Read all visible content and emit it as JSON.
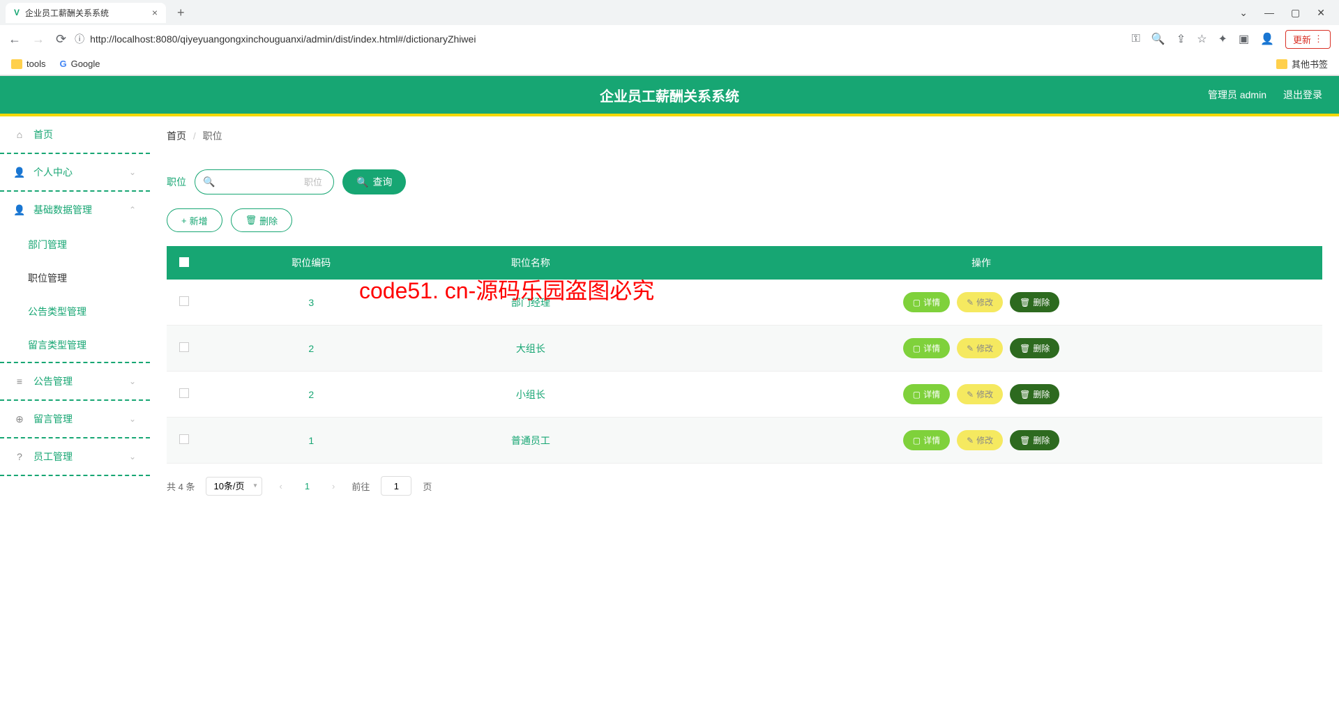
{
  "browser": {
    "tab_title": "企业员工薪酬关系系统",
    "url": "http://localhost:8080/qiyeyuangongxinchouguanxi/admin/dist/index.html#/dictionaryZhiwei",
    "update_label": "更新",
    "bookmarks": {
      "tools": "tools",
      "google": "Google",
      "other": "其他书签"
    }
  },
  "header": {
    "title": "企业员工薪酬关系系统",
    "user_label": "管理员 admin",
    "logout_label": "退出登录"
  },
  "sidebar": {
    "home": "首页",
    "personal": "个人中心",
    "basedata": "基础数据管理",
    "sub": {
      "dept": "部门管理",
      "position": "职位管理",
      "notice_type": "公告类型管理",
      "message_type": "留言类型管理"
    },
    "notice": "公告管理",
    "message": "留言管理",
    "employee": "员工管理"
  },
  "breadcrumb": {
    "home": "首页",
    "current": "职位"
  },
  "search": {
    "label": "职位",
    "placeholder": "职位",
    "query_btn": "查询"
  },
  "actions": {
    "add": "新增",
    "delete": "删除"
  },
  "table": {
    "headers": {
      "code": "职位编码",
      "name": "职位名称",
      "ops": "操作"
    },
    "rows": [
      {
        "code": "3",
        "name": "部门经理"
      },
      {
        "code": "2",
        "name": "大组长"
      },
      {
        "code": "2",
        "name": "小组长"
      },
      {
        "code": "1",
        "name": "普通员工"
      }
    ],
    "row_actions": {
      "detail": "详情",
      "edit": "修改",
      "delete": "删除"
    }
  },
  "pagination": {
    "total_label": "共 4 条",
    "page_size": "10条/页",
    "current": "1",
    "jump_prefix": "前往",
    "jump_value": "1",
    "jump_suffix": "页"
  },
  "watermark": "code51. cn-源码乐园盗图必究"
}
